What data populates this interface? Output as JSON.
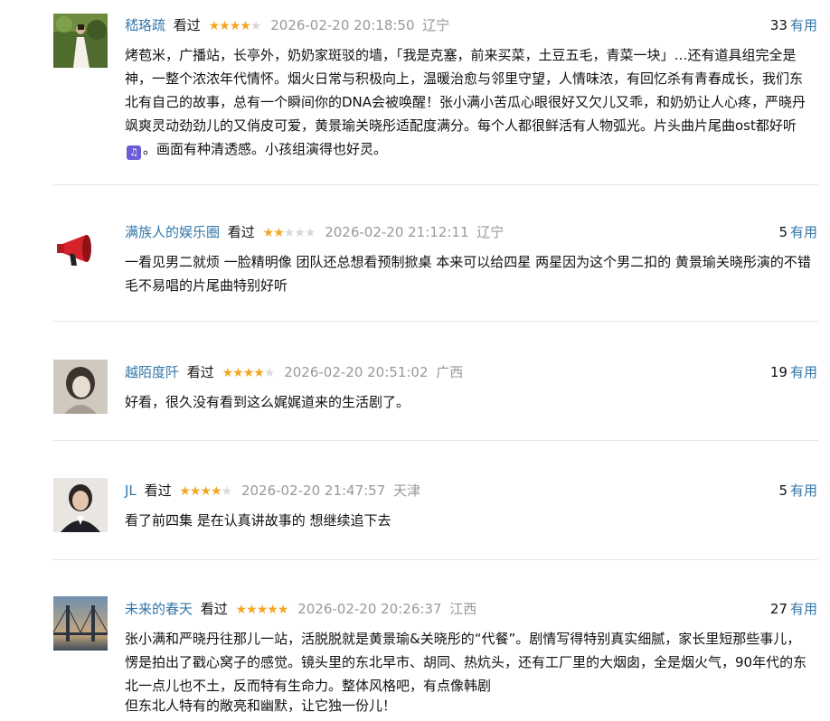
{
  "reviews": [
    {
      "username": "嵇珞疏",
      "status": "看过",
      "rating": 4,
      "datetime": "2026-02-20 20:18:50",
      "region": "辽宁",
      "useful_count": "33",
      "useful_label": "有用",
      "avatar": "woman-in-white-dress-photo",
      "content_before_icon": "烤苞米，广播站，长亭外，奶奶家斑驳的墙，「我是克塞，前来买菜，土豆五毛，青菜一块」…还有道具组完全是神，一整个浓浓年代情怀。烟火日常与积极向上，温暖治愈与邻里守望，人情味浓，有回忆杀有青春成长，我们东北有自己的故事，总有一个瞬间你的DNA会被唤醒！张小满小苦瓜心眼很好又欠儿又乖，和奶奶让人心疼，严晓丹飒爽灵动劲劲儿的又俏皮可爱，黄景瑜关晓彤适配度满分。每个人都很鲜活有人物弧光。片头曲片尾曲ost都好听",
      "emoji": "music-note-emoji",
      "content_after_icon": "。画面有种清透感。小孩组演得也好灵。"
    },
    {
      "username": "满族人的娱乐圈",
      "status": "看过",
      "rating": 2,
      "datetime": "2026-02-20 21:12:11",
      "region": "辽宁",
      "useful_count": "5",
      "useful_label": "有用",
      "avatar": "red-megaphone",
      "content": "一看见男二就烦 一脸精明像 团队还总想看预制掀桌 本来可以给四星 两星因为这个男二扣的 黄景瑜关晓彤演的不错 毛不易唱的片尾曲特别好听"
    },
    {
      "username": "越陌度阡",
      "status": "看过",
      "rating": 4,
      "datetime": "2026-02-20 20:51:02",
      "region": "广西",
      "useful_count": "19",
      "useful_label": "有用",
      "avatar": "vintage-portrait-photo",
      "content": "好看，很久没有看到这么娓娓道来的生活剧了。"
    },
    {
      "username": "JL",
      "status": "看过",
      "rating": 4,
      "datetime": "2026-02-20 21:47:57",
      "region": "天津",
      "useful_count": "5",
      "useful_label": "有用",
      "avatar": "man-in-suit-photo",
      "content": "看了前四集 是在认真讲故事的 想继续追下去"
    },
    {
      "username": "未来的春天",
      "status": "看过",
      "rating": 5,
      "datetime": "2026-02-20 20:26:37",
      "region": "江西",
      "useful_count": "27",
      "useful_label": "有用",
      "avatar": "bridge-at-sunset-photo",
      "content": "张小满和严晓丹往那儿一站，活脱脱就是黄景瑜&关晓彤的“代餐”。剧情写得特别真实细腻，家长里短那些事儿，愣是拍出了戳心窝子的感觉。镜头里的东北早市、胡同、热炕头，还有工厂里的大烟囱，全是烟火气，90年代的东北一点儿也不土，反而特有生命力。整体风格吧，有点像韩剧",
      "content_line_end": "但东北人特有的敞亮和幽默，让它独一份儿！"
    }
  ],
  "colors": {
    "link": "#3377aa",
    "star_on": "#f5a623",
    "star_off": "#d9d9d9",
    "meta": "#999999",
    "divider": "#e6e6e6"
  }
}
